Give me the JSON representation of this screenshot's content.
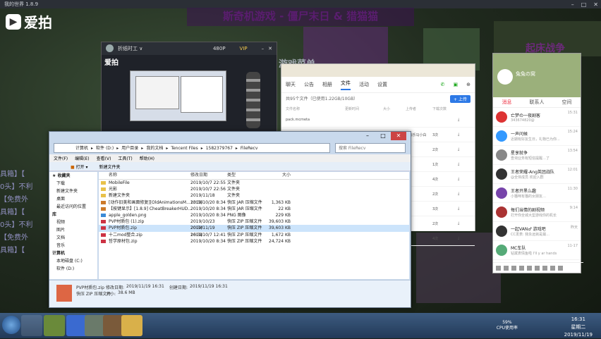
{
  "window_title": "我的世界 1.8.9",
  "watermark": "爱拍",
  "game": {
    "banner": "斯奇机游戏 - 僵尸末日 & 猎猫猫",
    "sub_title": "游戏菜单",
    "right_title": "起床战争",
    "left_lines": [
      "具箱】【",
      "0头】不利",
      "【免费外",
      "具箱】【",
      "0头】不利",
      "【免费外",
      "具箱】【"
    ]
  },
  "phone_window": {
    "title": "折纸时工 ∨",
    "quality": "480P",
    "vip": "VIP",
    "watermark": "爱拍"
  },
  "chat_window": {
    "tabs": [
      "聊天",
      "公告",
      "相册",
      "文件",
      "活动",
      "设置"
    ],
    "active_tab": "文件",
    "file_info": "共95个文件（已使用1.22GB/10GB）",
    "upload_button": "上传",
    "columns": [
      "文件名称",
      "更新时间",
      "大小",
      "上传者",
      "下载次数"
    ],
    "rows": [
      {
        "name": "pack.mcmeta",
        "time": "",
        "size": "",
        "uploader": "",
        "downloads": ""
      },
      {
        "name": "2c1ab510b912c8fc0...",
        "time": "2019-09-17 16:34",
        "size": "51.3KB",
        "uploader": "☆快乐马小白",
        "downloads": "3次"
      },
      {
        "name": "",
        "time": "",
        "size": "",
        "uploader": "",
        "downloads": "2次"
      },
      {
        "name": "",
        "time": "",
        "size": "",
        "uploader": "",
        "downloads": "1次"
      },
      {
        "name": "",
        "time": "",
        "size": "",
        "uploader": "",
        "downloads": "4次"
      },
      {
        "name": "",
        "time": "",
        "size": "",
        "uploader": "",
        "downloads": "2次"
      },
      {
        "name": "",
        "time": "",
        "size": "",
        "uploader": "",
        "downloads": "3次"
      },
      {
        "name": "",
        "time": "",
        "size": "",
        "uploader": "",
        "downloads": "2次"
      },
      {
        "name": "",
        "time": "",
        "size": "",
        "uploader": "",
        "downloads": "4次"
      }
    ]
  },
  "explorer": {
    "address": [
      "计算机",
      "软件 (D:)",
      "用户目录",
      "我的文档",
      "Tencent Files",
      "1582379767",
      "FileRecv"
    ],
    "search_placeholder": "搜索 FileRecv",
    "menu": [
      "文件(F)",
      "编辑(E)",
      "查看(V)",
      "工具(T)",
      "帮助(H)"
    ],
    "toolbar": [
      "打开",
      "新建文件夹"
    ],
    "nav": {
      "favorites": "收藏夹",
      "fav_items": [
        "下载",
        "新建文件夹",
        "桌面",
        "最近访问的位置"
      ],
      "library": "库",
      "lib_items": [
        "视频",
        "图片",
        "文档",
        "音乐"
      ],
      "computer": "计算机",
      "computer_items": [
        "本地磁盘 (C:)",
        "软件 (D:)"
      ]
    },
    "columns": {
      "name": "名称",
      "date": "修改日期",
      "type": "类型",
      "size": "大小"
    },
    "files": [
      {
        "name": "MobileFile",
        "date": "2019/10/7 22:55",
        "type": "文件夹",
        "size": "",
        "kind": "folder"
      },
      {
        "name": "光影",
        "date": "2019/10/7 22:56",
        "type": "文件夹",
        "size": "",
        "kind": "folder"
      },
      {
        "name": "新建文件夹",
        "date": "2019/11/18 13:36",
        "type": "文件夹",
        "size": "",
        "kind": "folder"
      },
      {
        "name": "[动作旧美和画面修复][OldAnimationsM...",
        "date": "2019/10/20 8:34",
        "type": "快压 JAR 压缩文件",
        "size": "1,363 KB",
        "kind": "jar"
      },
      {
        "name": "【按键显示】[1.8.9] CheatBreakerHUD...",
        "date": "2019/10/20 8:34",
        "type": "快压 JAR 压缩文件",
        "size": "22 KB",
        "kind": "jar"
      },
      {
        "name": "apple_golden.png",
        "date": "2019/10/20 8:34",
        "type": "PNG 图像",
        "size": "229 KB",
        "kind": "png"
      },
      {
        "name": "PVP材质包 (1).zip",
        "date": "2019/10/23 20:34",
        "type": "快压 ZIP 压缩文件",
        "size": "39,603 KB",
        "kind": "zip"
      },
      {
        "name": "PVP材质包.zip",
        "date": "2019/11/19 16:31",
        "type": "快压 ZIP 压缩文件",
        "size": "39,603 KB",
        "kind": "zip",
        "selected": true
      },
      {
        "name": "十二mod整合.zip",
        "date": "2019/10/7 12:41",
        "type": "快压 ZIP 压缩文件",
        "size": "1,672 KB",
        "kind": "zip"
      },
      {
        "name": "哲学原材包.zip",
        "date": "2019/10/20 8:34",
        "type": "快压 ZIP 压缩文件",
        "size": "24,724 KB",
        "kind": "zip"
      }
    ],
    "details": {
      "name": "PVP材质包.zip",
      "modified_label": "修改日期:",
      "modified": "2019/11/19 16:31",
      "created_label": "创建日期:",
      "created": "2019/11/19 16:31",
      "type": "快压 ZIP 压缩文件",
      "size_label": "大小:",
      "size": "38.6 MB"
    }
  },
  "qq": {
    "user": "兔兔の窝",
    "tabs": [
      "消息",
      "联系人",
      "空间"
    ],
    "active_tab": "消息",
    "items": [
      {
        "title": "亡梦の一夜剧客",
        "sub": "343674820@",
        "time": "15:31",
        "color": "#d33"
      },
      {
        "title": "一声问候",
        "sub": "近期有好友生日，礼物已为你...",
        "time": "15:24",
        "color": "#39f"
      },
      {
        "title": "星享就争",
        "sub": "查询业务有短信提醒…了",
        "time": "13:54",
        "color": "#888"
      },
      {
        "title": "王者荣耀-Ang英团战队",
        "sub": "@全体成员 欢迎入群",
        "time": "12:01",
        "color": "#333"
      },
      {
        "title": "王者开黑么趣",
        "sub": "小猫咪有猫的女朋友…",
        "time": "11:30",
        "color": "#74a"
      },
      {
        "title": "每们当情的剧视频",
        "sub": "打开你全城大型游戏你的机长",
        "time": "9:14",
        "color": "#a33"
      },
      {
        "title": "一起VAN♂ 游戏吧",
        "sub": "CC发表: 我永远就是最...",
        "time": "昨天",
        "color": "#333"
      },
      {
        "title": "MC车队",
        "sub": "钻斌表情鱼啦 I'll y ar hands",
        "time": "11-17",
        "color": "#5a7"
      }
    ]
  },
  "taskbar": {
    "cpu_percent": "59%",
    "cpu_label": "CPU使用率",
    "time": "16:31",
    "weekday": "星期二",
    "date": "2019/11/19"
  }
}
